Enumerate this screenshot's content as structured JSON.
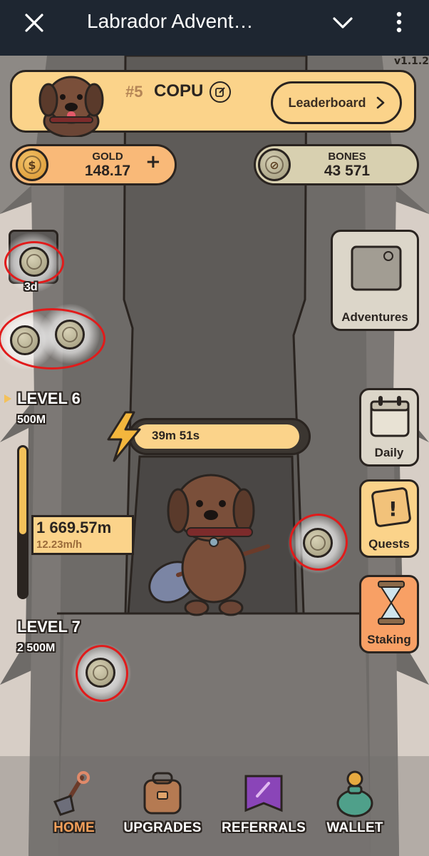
{
  "window": {
    "title": "Labrador Advent…",
    "version": "v1.1.2"
  },
  "icons": {
    "close": "close-icon",
    "dropdown": "chevron-down-icon",
    "menu": "more-vertical-icon"
  },
  "profile": {
    "rank": "#5",
    "name": "COPU",
    "leaderboard_label": "Leaderboard"
  },
  "gold": {
    "label": "GOLD",
    "value": "148.17",
    "add": "+"
  },
  "bones": {
    "label": "BONES",
    "value": "43 571"
  },
  "collectibles": {
    "partial_label": "3d"
  },
  "levels": [
    {
      "label": "LEVEL 6",
      "depth": "500M"
    },
    {
      "label": "LEVEL 7",
      "depth": "2 500M"
    }
  ],
  "progress": {
    "current_depth": "1 669.57m",
    "rate": "12.23m/h",
    "fraction": 0.58
  },
  "energy": {
    "timer": "39m 51s",
    "fraction": 0.97
  },
  "side_menu": {
    "adventures": "Adventures",
    "daily": "Daily",
    "quests": "Quests",
    "staking": "Staking"
  },
  "nav": [
    {
      "label": "HOME",
      "active": true
    },
    {
      "label": "UPGRADES",
      "active": false
    },
    {
      "label": "REFERRALS",
      "active": false
    },
    {
      "label": "WALLET",
      "active": false
    }
  ],
  "colors": {
    "accent": "#fbd38a",
    "active_nav": "#f5a05a",
    "gold_pill": "#f9b978",
    "bones_pill": "#d8d0b0",
    "highlight_ring": "#e11b1b"
  }
}
